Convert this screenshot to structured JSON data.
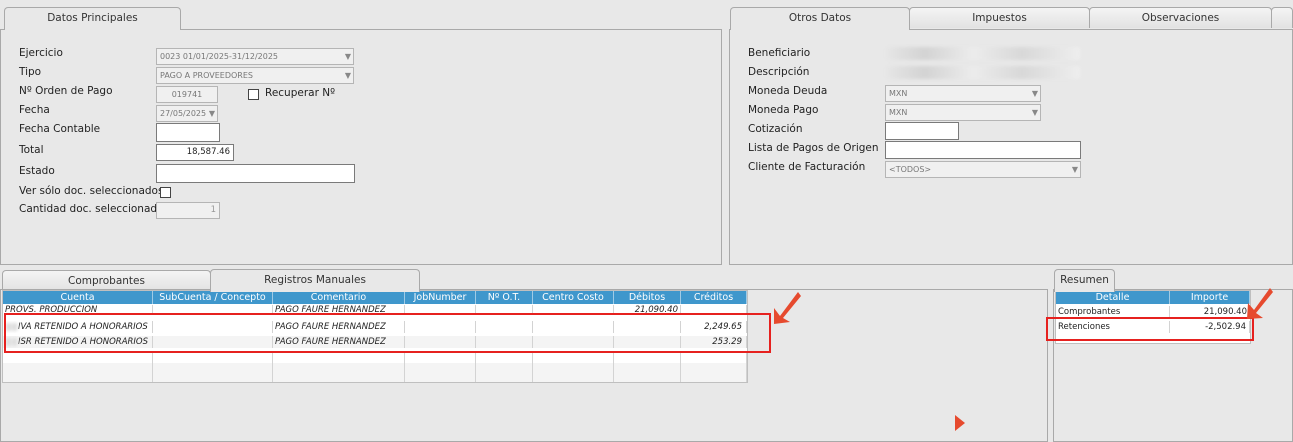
{
  "left_tabs": {
    "principal": "Datos Principales"
  },
  "principal": {
    "ejercicio_label": "Ejercicio",
    "ejercicio_value": "0023 01/01/2025-31/12/2025",
    "tipo_label": "Tipo",
    "tipo_value": "PAGO A PROVEEDORES",
    "orden_label": "Nº Orden de Pago",
    "orden_value": "019741",
    "recuperar_label": "Recuperar Nº",
    "fecha_label": "Fecha",
    "fecha_value": "27/05/2025",
    "fecha_contable_label": "Fecha Contable",
    "fecha_contable_value": "",
    "total_label": "Total",
    "total_value": "18,587.46",
    "estado_label": "Estado",
    "estado_value": "",
    "ver_solo_label": "Ver sólo doc. seleccionados",
    "cantidad_label": "Cantidad doc. seleccionados",
    "cantidad_value": "1"
  },
  "right_tabs": {
    "otros": "Otros Datos",
    "impuestos": "Impuestos",
    "observaciones": "Observaciones"
  },
  "otros": {
    "beneficiario_label": "Beneficiario",
    "descripcion_label": "Descripción",
    "moneda_deuda_label": "Moneda Deuda",
    "moneda_deuda_value": "MXN",
    "moneda_pago_label": "Moneda Pago",
    "moneda_pago_value": "MXN",
    "cotizacion_label": "Cotización",
    "cotizacion_value": "",
    "lista_label": "Lista de Pagos de Origen",
    "lista_value": "",
    "cliente_label": "Cliente de Facturación",
    "cliente_value": "<TODOS>"
  },
  "bottom_tabs": {
    "comprobantes": "Comprobantes",
    "registros": "Registros Manuales"
  },
  "registros_grid": {
    "headers": [
      "Cuenta",
      "SubCuenta / Concepto",
      "Comentario",
      "JobNumber",
      "Nº O.T.",
      "Centro Costo",
      "Débitos",
      "Créditos"
    ],
    "rows": [
      [
        "PROVS. PRODUCCION",
        "",
        "PAGO FAURE HERNANDEZ",
        "",
        "",
        "",
        "21,090.40",
        ""
      ],
      [
        "IVA RETENIDO A HONORARIOS",
        "",
        "PAGO FAURE HERNANDEZ",
        "",
        "",
        "",
        "",
        "2,249.65"
      ],
      [
        "ISR RETENIDO A HONORARIOS",
        "",
        "PAGO FAURE HERNANDEZ",
        "",
        "",
        "",
        "",
        "253.29"
      ]
    ]
  },
  "resumen": {
    "tab": "Resumen",
    "headers": [
      "Detalle",
      "Importe"
    ],
    "rows": [
      [
        "Comprobantes",
        "21,090.40"
      ],
      [
        "Retenciones",
        "-2,502.94"
      ]
    ]
  },
  "colors": {
    "accent": "#3f97cc",
    "highlight": "#e6211f"
  }
}
